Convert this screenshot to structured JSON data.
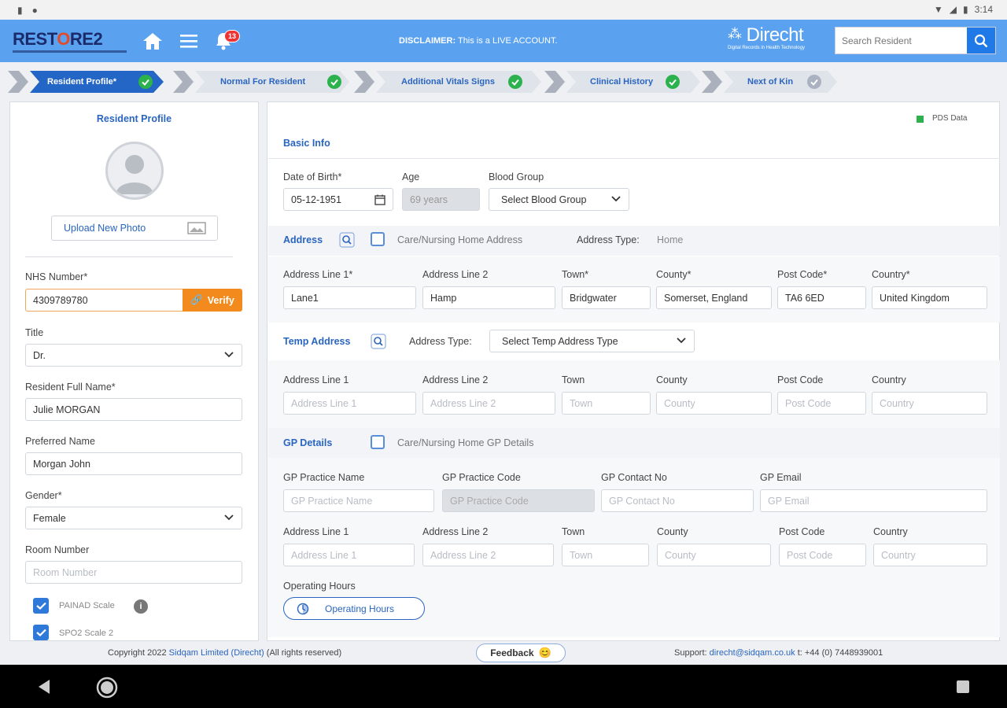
{
  "statusbar": {
    "time": "3:14"
  },
  "header": {
    "logo": "RESTORE2",
    "badge_count": "13",
    "disclaimer_label": "DISCLAIMER:",
    "disclaimer_text": "This is a LIVE ACCOUNT.",
    "brand_name": "Direcht",
    "brand_sub": "Digital Records in Health Technology",
    "search_placeholder": "Search Resident"
  },
  "steps": [
    {
      "label": "Resident Profile*",
      "status": "done"
    },
    {
      "label": "Normal For Resident",
      "status": "done"
    },
    {
      "label": "Additional Vitals Signs",
      "status": "done"
    },
    {
      "label": "Clinical History",
      "status": "done"
    },
    {
      "label": "Next of Kin",
      "status": "pending"
    }
  ],
  "left": {
    "title": "Resident Profile",
    "upload_label": "Upload New Photo",
    "nhs_label": "NHS Number*",
    "nhs_value": "4309789780",
    "verify_label": "Verify",
    "title_label": "Title",
    "title_value": "Dr.",
    "fullname_label": "Resident Full Name*",
    "fullname_value": "Julie MORGAN",
    "preferred_label": "Preferred Name",
    "preferred_value": "Morgan John",
    "gender_label": "Gender*",
    "gender_value": "Female",
    "room_label": "Room Number",
    "room_placeholder": "Room Number",
    "painad_label": "PAINAD Scale",
    "spo2_label": "SPO2 Scale 2"
  },
  "right": {
    "pds_label": "PDS Data",
    "basic_info": "Basic Info",
    "dob_label": "Date of Birth*",
    "dob_value": "05-12-1951",
    "age_label": "Age",
    "age_value": "69 years",
    "blood_label": "Blood Group",
    "blood_value": "Select Blood Group",
    "address_title": "Address",
    "care_home_address": "Care/Nursing Home Address",
    "address_type_label": "Address Type:",
    "address_type_value": "Home",
    "addr": {
      "l1_label": "Address Line 1*",
      "l1": "Lane1",
      "l2_label": "Address Line 2",
      "l2": "Hamp",
      "town_label": "Town*",
      "town": "Bridgwater",
      "county_label": "County*",
      "county": "Somerset, England",
      "post_label": "Post Code*",
      "post": "TA6 6ED",
      "country_label": "Country*",
      "country": "United Kingdom"
    },
    "temp_title": "Temp Address",
    "temp_type_label": "Address Type:",
    "temp_type_value": "Select Temp Address Type",
    "temp": {
      "l1_label": "Address Line 1",
      "l1_ph": "Address Line 1",
      "l2_label": "Address Line 2",
      "l2_ph": "Address Line 2",
      "town_label": "Town",
      "town_ph": "Town",
      "county_label": "County",
      "county_ph": "County",
      "post_label": "Post Code",
      "post_ph": "Post Code",
      "country_label": "Country",
      "country_ph": "Country"
    },
    "gp_title": "GP Details",
    "gp_care_label": "Care/Nursing Home GP Details",
    "gp": {
      "name_label": "GP Practice Name",
      "name_ph": "GP Practice Name",
      "code_label": "GP Practice Code",
      "code_ph": "GP Practice Code",
      "contact_label": "GP Contact No",
      "contact_ph": "GP Contact No",
      "email_label": "GP Email",
      "email_ph": "GP Email",
      "l1_label": "Address Line 1",
      "l1_ph": "Address Line 1",
      "l2_label": "Address Line 2",
      "l2_ph": "Address Line 2",
      "town_label": "Town",
      "town_ph": "Town",
      "county_label": "County",
      "county_ph": "County",
      "post_label": "Post Code",
      "post_ph": "Post Code",
      "country_label": "Country",
      "country_ph": "Country"
    },
    "op_hours_label": "Operating Hours",
    "op_hours_button": "Operating Hours"
  },
  "footer": {
    "copyright_prefix": "Copyright 2022",
    "company": "Sidqam Limited (Direcht)",
    "rights": "(All rights reserved)",
    "feedback": "Feedback",
    "support_label": "Support:",
    "support_email": "direcht@sidqam.co.uk",
    "support_phone": "t: +44 (0) 7448939001"
  },
  "colors": {
    "header": "#5aa2f0",
    "accent": "#2a65c0",
    "check": "#2bb24c",
    "verify": "#f28a1d"
  }
}
